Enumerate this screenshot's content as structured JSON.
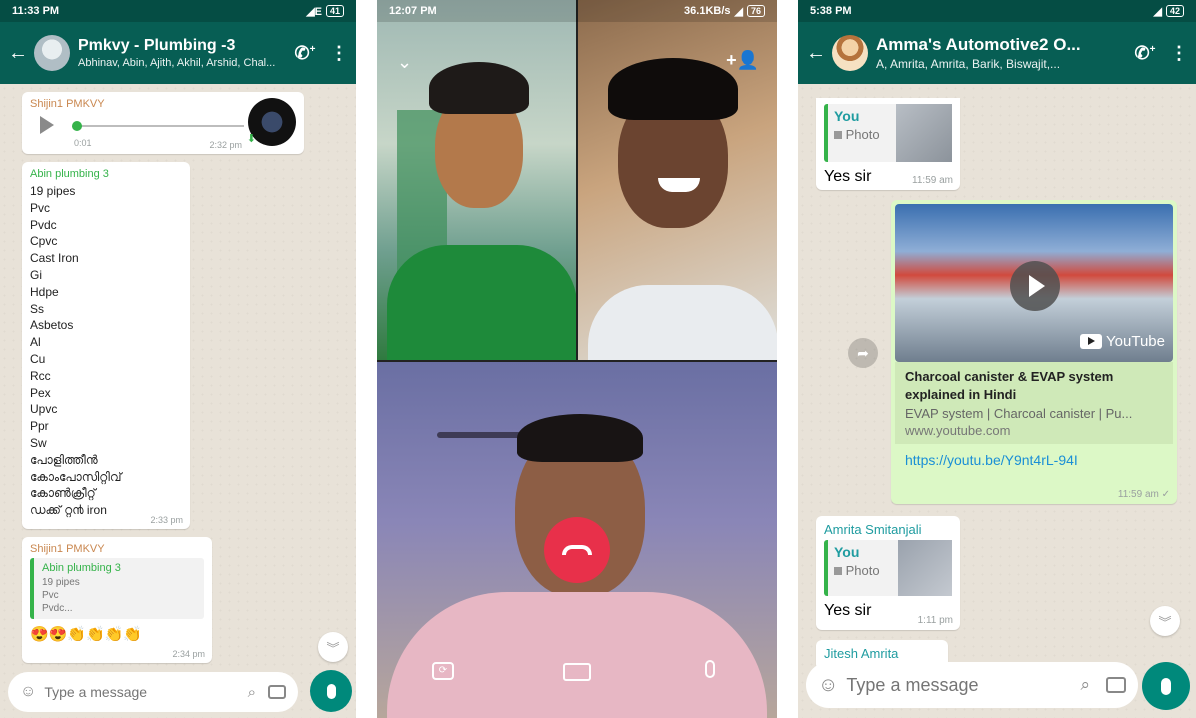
{
  "panel1": {
    "status": {
      "time": "11:33 PM",
      "battery": "41"
    },
    "header": {
      "title": "Pmkvy - Plumbing -3",
      "subtitle": "Abhinav, Abin, Ajith, Akhil, Arshid, Chal..."
    },
    "voice_message": {
      "sender": "Shijin1 PMKVY",
      "duration": "0:01",
      "time": "2:32 pm"
    },
    "list_message": {
      "sender": "Abin plumbing 3",
      "lines": [
        "19 pipes",
        "Pvc",
        "Pvdc",
        "Cpvc",
        "Cast Iron",
        "Gi",
        "Hdpe",
        "Ss",
        "Asbetos",
        "Al",
        "Cu",
        "Rcc",
        "Pex",
        "Upvc",
        "Ppr",
        "Sw",
        "പോളിത്തീൻ",
        "കോംപോസിറ്റിവ്",
        "കോൺക്രീറ്റ്",
        "ഡക്ക് റ്റ൯ iron"
      ],
      "time": "2:33 pm"
    },
    "reply_message": {
      "sender": "Shijin1 PMKVY",
      "quote_sender": "Abin plumbing 3",
      "quote_lines": [
        "19 pipes",
        "Pvc",
        "Pvdc..."
      ],
      "emojis": "😍😍👏👏👏👏",
      "time": "2:34 pm"
    },
    "input": {
      "placeholder": "Type a message"
    }
  },
  "panel2": {
    "status": {
      "time": "12:07 PM",
      "network": "36.1KB/s",
      "battery": "76"
    }
  },
  "panel3": {
    "status": {
      "time": "5:38 PM",
      "battery": "42"
    },
    "header": {
      "title": "Amma's Automotive2 O...",
      "subtitle": "A, Amrita, Amrita, Barik, Biswajit,..."
    },
    "reply1": {
      "quote_sender": "You",
      "quote_type": "Photo",
      "text": "Yes sir",
      "time": "11:59 am"
    },
    "link_message": {
      "brand": "YouTube",
      "title": "Charcoal canister & EVAP system explained in Hindi",
      "description": "EVAP system | Charcoal canister | Pu...",
      "domain": "www.youtube.com",
      "url": "https://youtu.be/Y9nt4rL-94I",
      "time": "11:59 am ✓"
    },
    "reply2": {
      "sender": "Amrita Smitanjali",
      "quote_sender": "You",
      "quote_type": "Photo",
      "text": "Yes sir",
      "time": "1:11 pm"
    },
    "partial_sender": "Jitesh Amrita",
    "input": {
      "placeholder": "Type a message"
    }
  },
  "colors": {
    "header": "#075e54",
    "statusbar": "#054d44",
    "accent": "#00897b",
    "outgoing": "#dcf8c6",
    "end_call": "#e8304a"
  }
}
